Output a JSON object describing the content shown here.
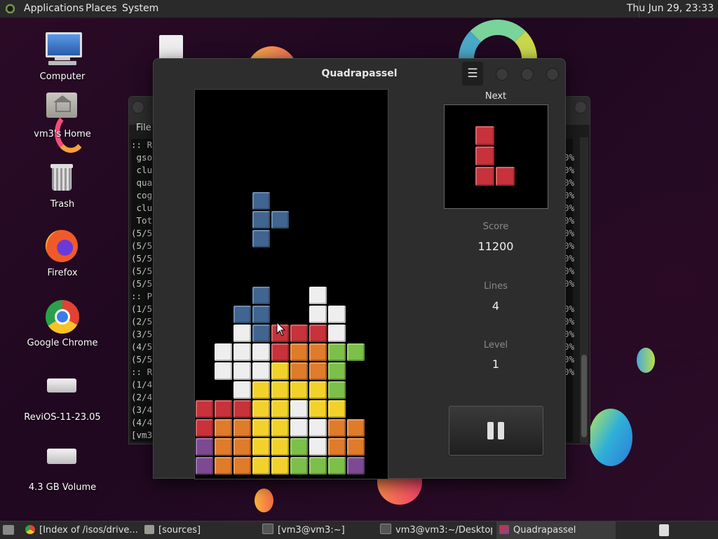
{
  "top_panel": {
    "menus": [
      "Applications",
      "Places",
      "System"
    ],
    "clock": "Thu Jun 29, 23:33"
  },
  "desktop_icons": [
    {
      "label": "Computer",
      "icon": "computer-icon"
    },
    {
      "label": "vm3's Home",
      "icon": "home-folder-icon"
    },
    {
      "label": "Trash",
      "icon": "trash-icon"
    },
    {
      "label": "Firefox",
      "icon": "firefox-icon"
    },
    {
      "label": "Google Chrome",
      "icon": "chrome-icon"
    },
    {
      "label": "ReviOS-11-23.05",
      "icon": "drive-icon"
    },
    {
      "label": "4.3 GB Volume",
      "icon": "drive-icon"
    }
  ],
  "terminal": {
    "menu_label": "File",
    "lines": [
      ":: R",
      " gso",
      " clu",
      " qua",
      " cog",
      " clu",
      " Tot",
      "(5/5",
      "(5/5",
      "(5/5",
      "(5/5",
      "(5/5",
      ":: P",
      "(1/5",
      "(2/5",
      "(3/5",
      "(4/5",
      "(5/5",
      ":: R",
      "(1/4",
      "(2/4",
      "(3/4",
      "(4/4",
      "[vm3"
    ],
    "right_col": [
      "",
      "00%",
      "00%",
      "00%",
      "00%",
      "00%",
      "00%",
      "00%",
      "00%",
      "00%",
      "00%",
      "00%",
      "",
      "00%",
      "00%",
      "00%",
      "00%",
      "00%",
      "00%",
      "",
      "",
      "",
      "",
      ""
    ]
  },
  "game": {
    "title": "Quadrapassel",
    "menu_icon": "☰",
    "next_label": "Next",
    "score_label": "Score",
    "score_value": "11200",
    "lines_label": "Lines",
    "lines_value": "4",
    "level_label": "Level",
    "level_value": "1",
    "colors": {
      "R": "#c8323a",
      "O": "#e07b2a",
      "Y": "#f2d22a",
      "G": "#7cc04a",
      "W": "#eeeeee",
      "B": "#3f6590",
      "P": "#7d4a92"
    },
    "falling_piece": [
      [
        3,
        5
      ],
      [
        3,
        6
      ],
      [
        4,
        6
      ],
      [
        3,
        7
      ]
    ],
    "falling_color": "B",
    "board_rows": [
      "...B..W...",
      "..BB..WW..",
      "..WBRRRW..",
      ".WWWROOGG.",
      ".WWWYOOG..",
      "..WYYYYG..",
      "RRRYYWYY..",
      "ROOYYWWOO.",
      "POOYYGWOO.",
      "POOYYGGGP."
    ],
    "board_row_start": 10,
    "next_piece": [
      [
        0,
        0
      ],
      [
        0,
        1
      ],
      [
        0,
        2
      ],
      [
        1,
        2
      ]
    ],
    "next_color": "R"
  },
  "taskbar": {
    "tasks": [
      {
        "label": "[Index of /isos/drive...",
        "icon": "chrome-icon",
        "active": false
      },
      {
        "label": "[sources]",
        "icon": "folder-icon",
        "active": false
      },
      {
        "label": "[vm3@vm3:~]",
        "icon": "terminal-icon",
        "active": false
      },
      {
        "label": "vm3@vm3:~/Desktop",
        "icon": "terminal-icon",
        "active": false
      },
      {
        "label": "Quadrapassel",
        "icon": "quadrapassel-icon",
        "active": true
      }
    ]
  }
}
